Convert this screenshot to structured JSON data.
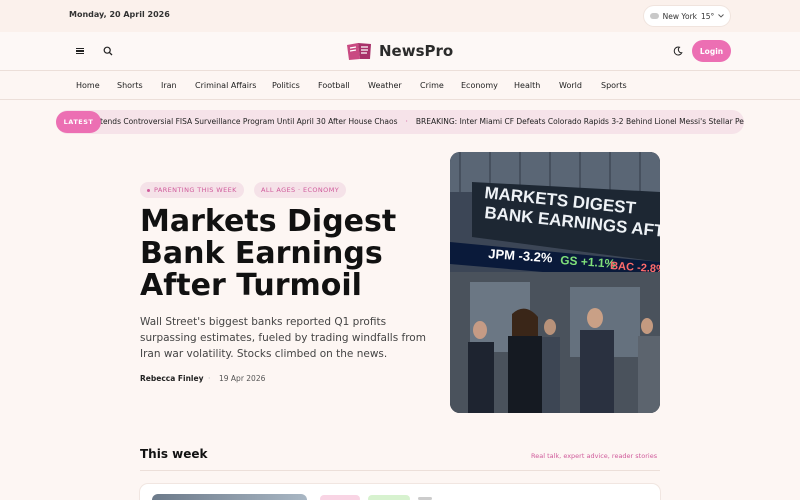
{
  "topbar": {
    "date": "Monday, 20 April 2026",
    "weather": {
      "city": "New York",
      "temp": "15°",
      "icon": "cloud-icon"
    }
  },
  "header": {
    "brand": "NewsPro",
    "login_label": "Login",
    "icons": [
      "menu-icon",
      "search-icon",
      "moon-icon"
    ]
  },
  "nav": {
    "items": [
      "Home",
      "Shorts",
      "Iran",
      "Criminal Affairs",
      "Politics",
      "Football",
      "Weather",
      "Crime",
      "Economy",
      "Health",
      "World",
      "Sports"
    ]
  },
  "ticker": {
    "label": "LATEST",
    "items": [
      "tends Controversial FISA Surveillance Program Until April 30 After House Chaos",
      "BREAKING: Inter Miami CF Defeats Colorado Rapids 3-2 Behind Lionel Messi's Stellar Performance"
    ],
    "separator": "·"
  },
  "hero": {
    "tag1": "PARENTING THIS WEEK",
    "tag2": "ALL AGES · ECONOMY",
    "title": "Markets Digest Bank Earnings After Turmoil",
    "dek": "Wall Street's biggest banks reported Q1 profits surpassing estimates, fueled by trading windfalls from Iran war volatility. Stocks climbed on the news.",
    "author": "Rebecca Finley",
    "date": "19 Apr 2026",
    "image": {
      "headline": "MARKETS DIGEST BANK EARNINGS AFTER TURM",
      "ticker": [
        {
          "symbol": "JPM",
          "change": "-3.2%"
        },
        {
          "symbol": "GS",
          "change": "+1.1%"
        },
        {
          "symbol": "BAC",
          "change": "-2.8%"
        }
      ]
    }
  },
  "section": {
    "title": "This week",
    "subtitle": "Real talk, expert advice, reader stories"
  },
  "colors": {
    "accent": "#ec6fb3",
    "accent_text": "#d05b9b",
    "background": "#fdf6f3"
  }
}
